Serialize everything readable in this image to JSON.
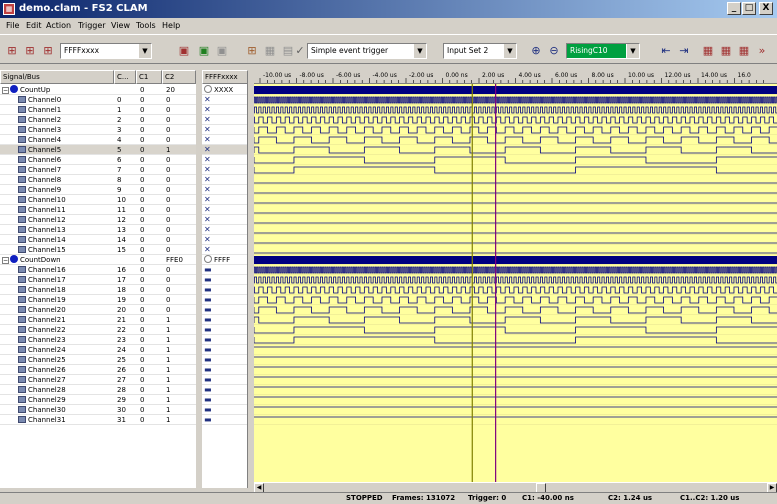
{
  "window": {
    "title": "demo.clam - FS2 CLAM",
    "icon": "app-icon",
    "minimize": "_",
    "maximize": "□",
    "close": "X"
  },
  "menu": [
    "File",
    "Edit",
    "Action",
    "Trigger",
    "View",
    "Tools",
    "Help"
  ],
  "toolbar": {
    "mask_combo": "FFFFxxxx",
    "trigger_combo": "Simple event trigger",
    "input_combo": "Input Set 2",
    "edge_combo": "RisingC10",
    "check_glyph": "✓",
    "colors": {
      "edge_combo_bg": "#00a040"
    }
  },
  "table": {
    "headers": {
      "signal": "Signal/Bus",
      "c": "C...",
      "c1": "C1",
      "c2": "C2",
      "val": "FFFFxxxx"
    },
    "groups": [
      {
        "name": "CountUp",
        "c1": "0",
        "c2": "20",
        "value": "XXXX",
        "toggle": "−"
      },
      {
        "name": "CountDown",
        "c1": "0",
        "c2": "FFE0",
        "value": "FFFF",
        "toggle": "−"
      }
    ],
    "channels_up": [
      {
        "name": "Channel0",
        "c": "0",
        "c1": "0",
        "c2": "0"
      },
      {
        "name": "Channel1",
        "c": "1",
        "c1": "0",
        "c2": "0"
      },
      {
        "name": "Channel2",
        "c": "2",
        "c1": "0",
        "c2": "0"
      },
      {
        "name": "Channel3",
        "c": "3",
        "c1": "0",
        "c2": "0"
      },
      {
        "name": "Channel4",
        "c": "4",
        "c1": "0",
        "c2": "0"
      },
      {
        "name": "Channel5",
        "c": "5",
        "c1": "0",
        "c2": "1"
      },
      {
        "name": "Channel6",
        "c": "6",
        "c1": "0",
        "c2": "0"
      },
      {
        "name": "Channel7",
        "c": "7",
        "c1": "0",
        "c2": "0"
      },
      {
        "name": "Channel8",
        "c": "8",
        "c1": "0",
        "c2": "0"
      },
      {
        "name": "Channel9",
        "c": "9",
        "c1": "0",
        "c2": "0"
      },
      {
        "name": "Channel10",
        "c": "10",
        "c1": "0",
        "c2": "0"
      },
      {
        "name": "Channel11",
        "c": "11",
        "c1": "0",
        "c2": "0"
      },
      {
        "name": "Channel12",
        "c": "12",
        "c1": "0",
        "c2": "0"
      },
      {
        "name": "Channel13",
        "c": "13",
        "c1": "0",
        "c2": "0"
      },
      {
        "name": "Channel14",
        "c": "14",
        "c1": "0",
        "c2": "0"
      },
      {
        "name": "Channel15",
        "c": "15",
        "c1": "0",
        "c2": "0"
      }
    ],
    "channels_down": [
      {
        "name": "Channel16",
        "c": "16",
        "c1": "0",
        "c2": "0"
      },
      {
        "name": "Channel17",
        "c": "17",
        "c1": "0",
        "c2": "0"
      },
      {
        "name": "Channel18",
        "c": "18",
        "c1": "0",
        "c2": "0"
      },
      {
        "name": "Channel19",
        "c": "19",
        "c1": "0",
        "c2": "0"
      },
      {
        "name": "Channel20",
        "c": "20",
        "c1": "0",
        "c2": "0"
      },
      {
        "name": "Channel21",
        "c": "21",
        "c1": "0",
        "c2": "1"
      },
      {
        "name": "Channel22",
        "c": "22",
        "c1": "0",
        "c2": "1"
      },
      {
        "name": "Channel23",
        "c": "23",
        "c1": "0",
        "c2": "1"
      },
      {
        "name": "Channel24",
        "c": "24",
        "c1": "0",
        "c2": "1"
      },
      {
        "name": "Channel25",
        "c": "25",
        "c1": "0",
        "c2": "1"
      },
      {
        "name": "Channel26",
        "c": "26",
        "c1": "0",
        "c2": "1"
      },
      {
        "name": "Channel27",
        "c": "27",
        "c1": "0",
        "c2": "1"
      },
      {
        "name": "Channel28",
        "c": "28",
        "c1": "0",
        "c2": "1"
      },
      {
        "name": "Channel29",
        "c": "29",
        "c1": "0",
        "c2": "1"
      },
      {
        "name": "Channel30",
        "c": "30",
        "c1": "0",
        "c2": "1"
      },
      {
        "name": "Channel31",
        "c": "31",
        "c1": "0",
        "c2": "1"
      }
    ],
    "selected_channel": "Channel5"
  },
  "ruler_ticks": [
    "-10.00 us",
    "-8.00 us",
    "-6.00 us",
    "-4.00 us",
    "-2.00 us",
    "0.00 ns",
    "2.00 us",
    "4.00 us",
    "6.00 us",
    "8.00 us",
    "10.00 us",
    "12.00 us",
    "14.00 us",
    "16.0"
  ],
  "waves": {
    "colors": {
      "bg": "#ffff9f",
      "bus": "#000080",
      "signal": "#000080",
      "cursor1": "#808000",
      "cursor2": "#800080"
    },
    "cursor1_time_us": -0.04,
    "cursor2_time_us": 1.24
  },
  "status": {
    "state": "STOPPED",
    "frames": "Frames: 131072",
    "trigger": "Trigger: 0",
    "c1": "C1: -40.00 ns",
    "c2": "C2: 1.24 us",
    "c1c2": "C1..C2: 1.20 us"
  }
}
